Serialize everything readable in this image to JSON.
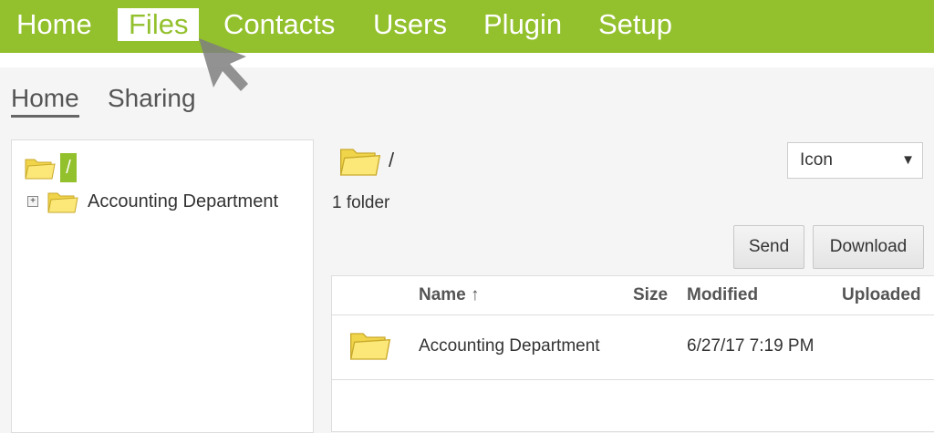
{
  "topnav": {
    "items": [
      {
        "label": "Home"
      },
      {
        "label": "Files",
        "active": true
      },
      {
        "label": "Contacts"
      },
      {
        "label": "Users"
      },
      {
        "label": "Plugin"
      },
      {
        "label": "Setup"
      }
    ]
  },
  "subtabs": [
    {
      "label": "Home",
      "active": true
    },
    {
      "label": "Sharing"
    }
  ],
  "tree": {
    "root_label": "/",
    "expander": "+",
    "items": [
      {
        "label": "Accounting Department"
      }
    ]
  },
  "breadcrumb": {
    "path": "/"
  },
  "folder_count": "1 folder",
  "view_select": {
    "value": "Icon",
    "arrow": "▼"
  },
  "buttons": {
    "send": "Send",
    "download": "Download"
  },
  "table": {
    "headers": {
      "name": "Name ↑",
      "size": "Size",
      "modified": "Modified",
      "uploaded": "Uploaded"
    },
    "rows": [
      {
        "name": "Accounting Department",
        "size": "",
        "modified": "6/27/17 7:19 PM",
        "uploaded": ""
      }
    ]
  },
  "colors": {
    "accent": "#93c02d",
    "folder": "#f3da55"
  }
}
